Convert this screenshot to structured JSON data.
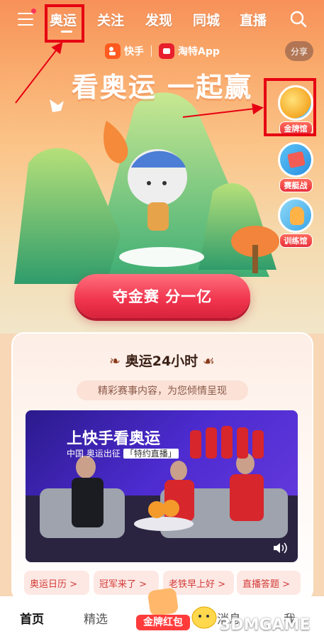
{
  "nav": {
    "items": [
      "奥运",
      "关注",
      "发现",
      "同城",
      "直播"
    ],
    "active_index": 0
  },
  "brand": {
    "kuaishou": "快手",
    "taote": "淘特App",
    "share": "分享"
  },
  "hero": {
    "slogan": "看奥运 一起赢"
  },
  "side_entries": [
    {
      "label": "金牌馆",
      "icon": "gold-medal-icon"
    },
    {
      "label": "赛艇战",
      "icon": "rowing-icon"
    },
    {
      "label": "训练馆",
      "icon": "training-icon"
    }
  ],
  "cta": {
    "label": "夺金赛 分一亿"
  },
  "section": {
    "title": "奥运24小时",
    "subtitle": "精彩赛事内容，为您倾情呈现"
  },
  "video": {
    "title": "上快手看奥运",
    "subtitle_prefix": "中国",
    "subtitle_mid": "奥运出征",
    "subtitle_tag": "「特约直播」"
  },
  "chips": [
    "奥运日历 >",
    "冠军来了 >",
    "老铁早上好 >",
    "直播答题 >"
  ],
  "tabbar": {
    "items": [
      "首页",
      "精选",
      "金牌红包",
      "消息",
      "我"
    ],
    "active_index": 0
  },
  "watermark": "3DMGAME",
  "colors": {
    "highlight": "#e60012",
    "accent": "#f0344d"
  }
}
